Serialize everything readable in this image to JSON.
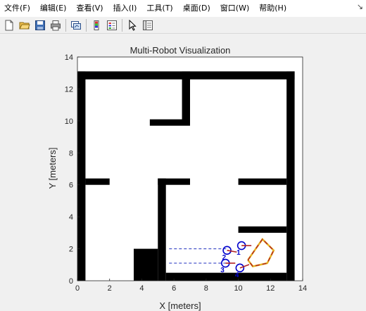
{
  "menubar": {
    "items": [
      "文件(F)",
      "编辑(E)",
      "查看(V)",
      "插入(I)",
      "工具(T)",
      "桌面(D)",
      "窗口(W)",
      "帮助(H)"
    ],
    "overflow_icon": "arrow-icon"
  },
  "toolbar": {
    "buttons": [
      {
        "name": "new-figure-button",
        "icon": "new-file-icon"
      },
      {
        "name": "open-file-button",
        "icon": "folder-open-icon"
      },
      {
        "name": "save-figure-button",
        "icon": "save-icon"
      },
      {
        "name": "print-figure-button",
        "icon": "printer-icon"
      },
      {
        "name": "link-plot-button",
        "icon": "link-plot-icon"
      },
      {
        "name": "insert-colorbar-button",
        "icon": "colorbar-icon"
      },
      {
        "name": "insert-legend-button",
        "icon": "legend-icon"
      },
      {
        "name": "edit-plot-button",
        "icon": "pointer-arrow-icon"
      },
      {
        "name": "property-inspector-button",
        "icon": "property-inspector-icon"
      }
    ]
  },
  "chart_data": {
    "type": "map",
    "title": "Multi-Robot Visualization",
    "xlabel": "X [meters]",
    "ylabel": "Y [meters]",
    "xlim": [
      0,
      14
    ],
    "ylim": [
      0,
      14
    ],
    "xticks": [
      0,
      2,
      4,
      6,
      8,
      10,
      12,
      14
    ],
    "yticks": [
      0,
      2,
      4,
      6,
      8,
      10,
      12,
      14
    ],
    "grid": false,
    "obstacles": [
      {
        "x0": 0,
        "x1": 13.5,
        "y0": 12.6,
        "y1": 13.1
      },
      {
        "x0": 0,
        "x1": 0.5,
        "y0": 0,
        "y1": 13.1
      },
      {
        "x0": 13.0,
        "x1": 13.5,
        "y0": 0,
        "y1": 13.1
      },
      {
        "x0": 6.5,
        "x1": 7.0,
        "y0": 9.8,
        "y1": 13.1
      },
      {
        "x0": 4.5,
        "x1": 7.0,
        "y0": 9.7,
        "y1": 10.1
      },
      {
        "x0": 0.5,
        "x1": 2.0,
        "y0": 6.0,
        "y1": 6.4
      },
      {
        "x0": 5.0,
        "x1": 7.0,
        "y0": 6.0,
        "y1": 6.4
      },
      {
        "x0": 5.0,
        "x1": 5.5,
        "y0": 0,
        "y1": 6.4
      },
      {
        "x0": 10.0,
        "x1": 13.0,
        "y0": 6.0,
        "y1": 6.4
      },
      {
        "x0": 10.0,
        "x1": 13.0,
        "y0": 3.0,
        "y1": 3.4
      },
      {
        "x0": 3.5,
        "x1": 5.0,
        "y0": 0,
        "y1": 2.0
      },
      {
        "x0": 5.5,
        "x1": 13.0,
        "y0": 0,
        "y1": 0.5
      }
    ],
    "robots": [
      {
        "label": "1",
        "x": 10.2,
        "y": 2.2,
        "heading_deg": 0
      },
      {
        "label": "2",
        "x": 9.3,
        "y": 1.9,
        "heading_deg": -10
      },
      {
        "label": "3",
        "x": 9.2,
        "y": 1.1,
        "heading_deg": 0
      },
      {
        "label": "4",
        "x": 10.1,
        "y": 0.8,
        "heading_deg": 20
      }
    ],
    "lidar_lines": [
      {
        "x0": 5.7,
        "y0": 2.0,
        "x1": 9.3,
        "y1": 2.0
      },
      {
        "x0": 5.7,
        "y0": 1.1,
        "x1": 9.2,
        "y1": 1.1
      }
    ],
    "trajectory": {
      "x": [
        10.6,
        11.5,
        12.2,
        11.8,
        10.9,
        10.6
      ],
      "y": [
        1.3,
        2.6,
        1.9,
        1.1,
        0.9,
        1.3
      ]
    },
    "colors": {
      "obstacle": "#000000",
      "robot": "#0000cc",
      "lidar": "#1f2fbf",
      "trajectory_red": "#b22222",
      "trajectory_yellow": "#e6b422",
      "trajectory_blue": "#5a9bd5"
    }
  }
}
